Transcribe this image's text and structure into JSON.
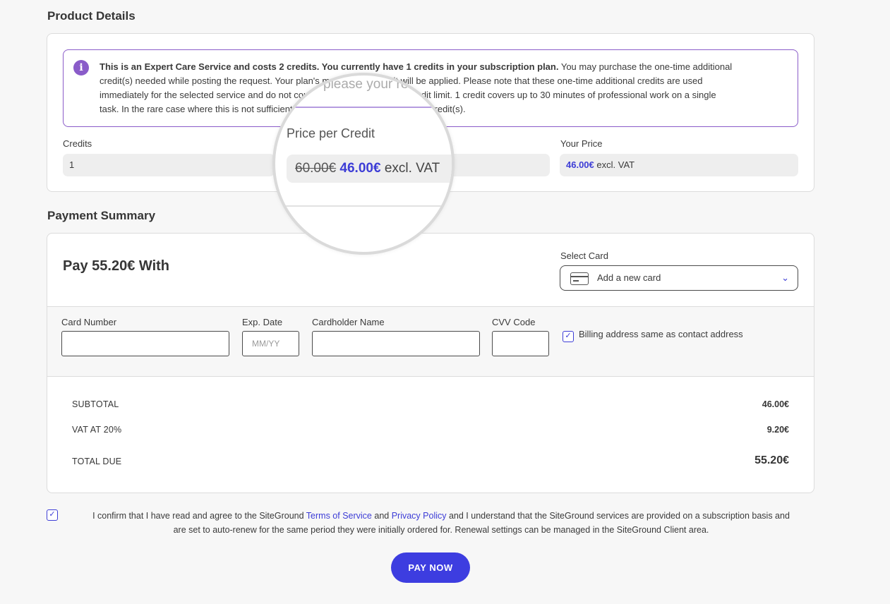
{
  "product_details": {
    "title": "Product Details",
    "notice": {
      "bold": "This is an Expert Care Service and costs 2 credits. You currently have 1 credits in your subscription plan.",
      "line1_rest": " You may purchase the one-time additional",
      "line2": "credit(s) needed while posting the request. Your plan's monthly credit limit will be applied. Please note that these one-time additional credits are used",
      "line3": "immediately for the selected service and do not count towards your monthly credit limit. 1 credit covers up to 30 minutes of professional work on a single",
      "line4": "task. In the rare case where this is not sufficient, you may be asked for additional credit(s)."
    },
    "credits_label": "Credits",
    "credits_value": "1",
    "price_per_credit_label": "Price per Credit",
    "old_price": "60.00€",
    "new_price": "46.00€",
    "excl_vat": "excl. VAT",
    "your_price_label": "Your Price",
    "your_price_value": "46.00€",
    "magnifier_blur_text": "please your re"
  },
  "payment_summary": {
    "title": "Payment Summary",
    "pay_with": "Pay 55.20€ With",
    "select_card_label": "Select Card",
    "select_card_value": "Add a new card",
    "card_number_label": "Card Number",
    "exp_date_label": "Exp. Date",
    "exp_date_placeholder": "MM/YY",
    "cardholder_label": "Cardholder Name",
    "cvv_label": "CVV Code",
    "billing_same_label": "Billing address same as contact address",
    "subtotal_label": "SUBTOTAL",
    "subtotal_value": "46.00€",
    "vat_label": "VAT AT 20%",
    "vat_value": "9.20€",
    "total_label": "TOTAL DUE",
    "total_value": "55.20€"
  },
  "terms": {
    "prefix": "I confirm that I have read and agree to the SiteGround ",
    "tos_link": "Terms of Service",
    "and": " and ",
    "privacy_link": "Privacy Policy",
    "suffix_line1": " and I understand that the SiteGround services are provided on a subscription basis and",
    "line2": "are set to auto-renew for the same period they were initially ordered for. Renewal settings can be managed in the SiteGround Client area."
  },
  "pay_now_label": "PAY NOW",
  "colors": {
    "accent": "#3d3dd6",
    "notice_border": "#8a5cc9"
  }
}
